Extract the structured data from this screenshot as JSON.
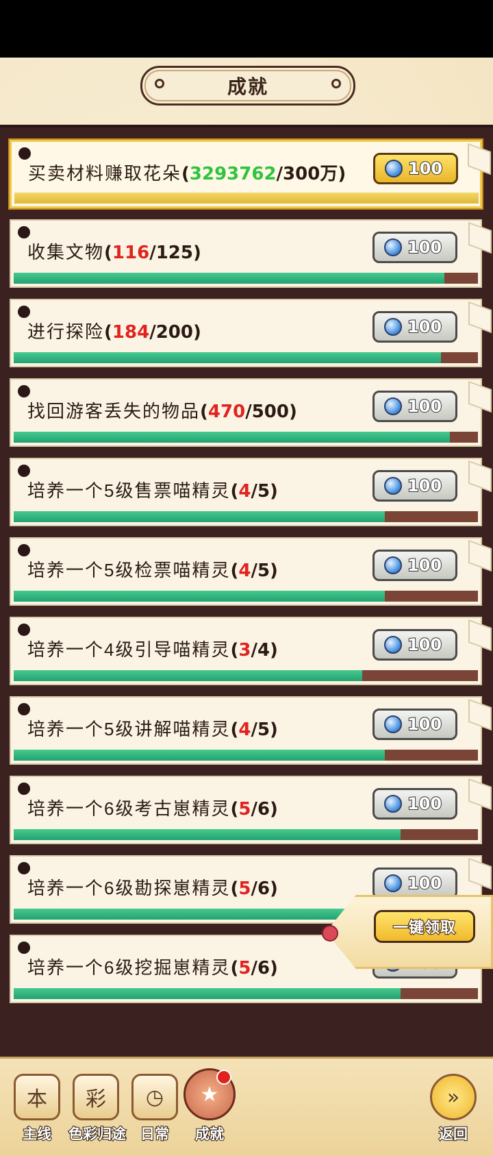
{
  "title": "成就",
  "achievements": [
    {
      "name": "买卖材料赚取花朵",
      "current": "3293762",
      "target": "300万",
      "reward": "100",
      "progress": 1.0,
      "done": true
    },
    {
      "name": "收集文物",
      "current": "116",
      "target": "125",
      "reward": "100",
      "progress": 0.928,
      "done": false
    },
    {
      "name": "进行探险",
      "current": "184",
      "target": "200",
      "reward": "100",
      "progress": 0.92,
      "done": false
    },
    {
      "name": "找回游客丢失的物品",
      "current": "470",
      "target": "500",
      "reward": "100",
      "progress": 0.94,
      "done": false
    },
    {
      "name": "培养一个5级售票喵精灵",
      "current": "4",
      "target": "5",
      "reward": "100",
      "progress": 0.8,
      "done": false
    },
    {
      "name": "培养一个5级检票喵精灵",
      "current": "4",
      "target": "5",
      "reward": "100",
      "progress": 0.8,
      "done": false
    },
    {
      "name": "培养一个4级引导喵精灵",
      "current": "3",
      "target": "4",
      "reward": "100",
      "progress": 0.75,
      "done": false
    },
    {
      "name": "培养一个5级讲解喵精灵",
      "current": "4",
      "target": "5",
      "reward": "100",
      "progress": 0.8,
      "done": false
    },
    {
      "name": "培养一个6级考古崽精灵",
      "current": "5",
      "target": "6",
      "reward": "100",
      "progress": 0.833,
      "done": false
    },
    {
      "name": "培养一个6级勘探崽精灵",
      "current": "5",
      "target": "6",
      "reward": "100",
      "progress": 0.833,
      "done": false
    },
    {
      "name": "培养一个6级挖掘崽精灵",
      "current": "5",
      "target": "6",
      "reward": "100",
      "progress": 0.833,
      "done": false
    }
  ],
  "claim_all_label": "一键领取",
  "nav": [
    {
      "label": "主线",
      "icon": "script-book-icon",
      "glyph": "本"
    },
    {
      "label": "色彩归途",
      "icon": "paint-palette-icon",
      "glyph": "彩"
    },
    {
      "label": "日常",
      "icon": "clock-icon",
      "glyph": "◷"
    },
    {
      "label": "成就",
      "icon": "trophy-badge-icon",
      "glyph": "★"
    },
    {
      "label": "返回",
      "icon": "back-arrow-icon",
      "glyph": "»"
    }
  ],
  "colors": {
    "current_red": "#e0231f",
    "current_green": "#2fc43e",
    "progress_green": "#23a271",
    "gold": "#f0b92b"
  }
}
